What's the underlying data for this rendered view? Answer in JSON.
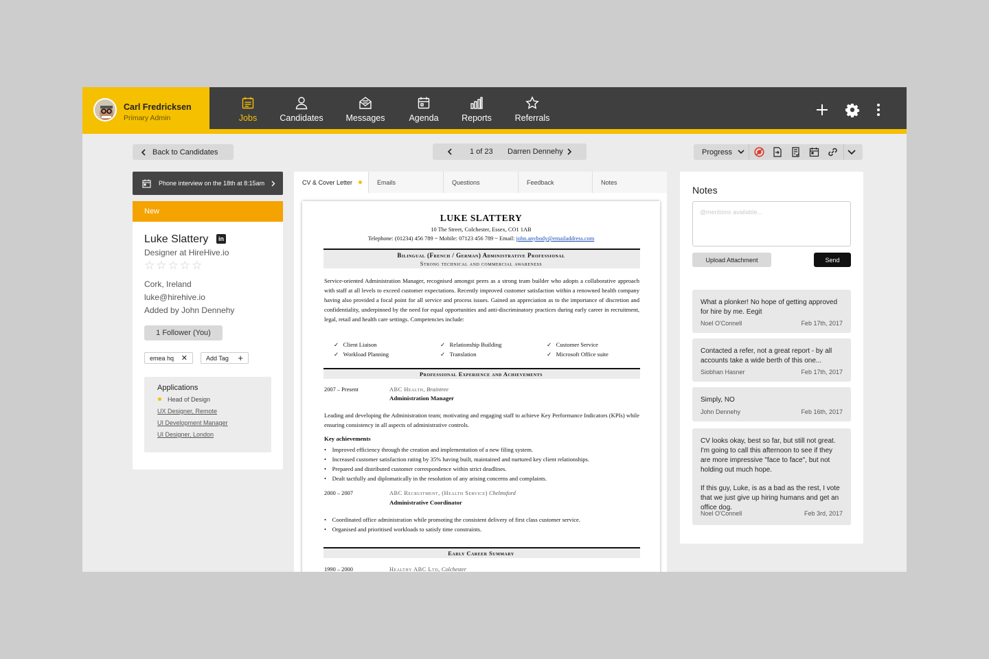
{
  "user": {
    "name": "Carl Fredricksen",
    "role": "Primary Admin"
  },
  "nav": [
    {
      "label": "Jobs",
      "icon": "calendar-list-icon",
      "active": true
    },
    {
      "label": "Candidates",
      "icon": "person-icon"
    },
    {
      "label": "Messages",
      "icon": "envelope-icon"
    },
    {
      "label": "Agenda",
      "icon": "calendar-icon"
    },
    {
      "label": "Reports",
      "icon": "bar-chart-icon"
    },
    {
      "label": "Referrals",
      "icon": "star-icon"
    }
  ],
  "top_actions": [
    "plus-icon",
    "gear-icon",
    "more-vertical-icon"
  ],
  "toolbar": {
    "back_label": "Back to Candidates",
    "pager_position": "1 of 23",
    "pager_name": "Darren Dennehy",
    "progress_label": "Progress"
  },
  "interview": {
    "text": "Phone interview on the 18th at 8:15am"
  },
  "candidate": {
    "status": "New",
    "name": "Luke Slattery",
    "title": "Designer at HireHive.io",
    "rating": 0,
    "stars": "☆☆☆☆☆",
    "location": "Cork, Ireland",
    "email": "luke@hirehive.io",
    "added_by": "Added by John Dennehy",
    "follower_label": "1 Follower (You)",
    "tags": [
      "emea hq"
    ],
    "add_tag_label": "Add Tag",
    "applications_title": "Applications",
    "applications": [
      "Head of Design",
      "UX Designer, Remote",
      "UI Development Manager",
      "UI Designer, London"
    ]
  },
  "tabs": [
    "CV & Cover Letter",
    "Emails",
    "Questions",
    "Feedback",
    "Notes"
  ],
  "cv": {
    "name": "LUKE SLATTERY",
    "address": "10 The Street, Colchester, Essex, CO1 1AB",
    "contact_prefix": "Telephone: (01234) 456 789 ~ Mobile: 07123 456 789 ~ Email: ",
    "contact_email": "john.anybody@emailaddress.com",
    "headline": "Bilingual (French / German) Administrative Professional",
    "subheadline": "Strong technical and commercial awareness",
    "summary": "Service-oriented Administration Manager, recognised amongst peers as a strong team builder who adopts a collaborative approach with staff at all levels to exceed customer expectations. Recently improved customer satisfaction within a renowned health company having also provided a focal point for all service and process issues. Gained an appreciation as to the importance of discretion and confidentiality, underpinned by the need for equal opportunities and anti-discriminatory practices during early career in recruitment, legal, retail and health care settings. Competencies include:",
    "competencies": [
      "Client Liaison",
      "Relationship Building",
      "Customer Service",
      "Workload Planning",
      "Translation",
      "Microsoft Office suite"
    ],
    "experience_heading": "Professional Experience and Achievements",
    "job1_dates": "2007 – Present",
    "job1_company": "ABC Health,",
    "job1_location": "Braintree",
    "job1_title": "Administration Manager",
    "job1_desc": "Leading and developing the Administration team; motivating and engaging staff to achieve Key Performance Indicators (KPIs) while ensuring consistency in all aspects of administrative controls.",
    "key_achievements_label": "Key achievements",
    "achievements": [
      "Improved efficiency through the creation and implementation of a new filing system.",
      "Increased customer satisfaction rating by 35% having built, maintained and nurtured key client relationships.",
      "Prepared and distributed customer correspondence within strict deadlines.",
      "Dealt tactfully and diplomatically in the resolution of any arising concerns and complaints."
    ],
    "job2_dates": "2000 – 2007",
    "job2_company": "ABC Recruitment, (Health Service)",
    "job2_location": "Chelmsford",
    "job2_title": "Administrative Coordinator",
    "job2_bullets": [
      "Coordinated office administration while promoting the consistent delivery of first class customer service.",
      "Organised and prioritised workloads to satisfy time constraints."
    ],
    "early_heading": "Early Career Summary",
    "job3_dates": "1990 – 2000",
    "job3_company": "Healthy ABC Ltd,",
    "job3_location": "Colchester"
  },
  "notes": {
    "title": "Notes",
    "placeholder": "@mentions available...",
    "upload_label": "Upload Attachment",
    "send_label": "Send",
    "items": [
      {
        "text": "What a plonker! No hope of getting approved for hire by me. Eegit",
        "author": "Noel O'Connell",
        "date": "Feb 17th, 2017"
      },
      {
        "text": "Contacted a refer, not a great report - by all accounts take a wide berth of this one...",
        "author": "Siobhan Hasner",
        "date": "Feb 17th, 2017"
      },
      {
        "text": "Simply, NO",
        "author": "John Dennehy",
        "date": "Feb 16th, 2017"
      },
      {
        "text": "CV looks okay, best so far, but still not great. I'm going to call this afternoon to see if they are more impressive \"face to face\", but not holding out much hope.",
        "text2": "If this guy, Luke, is as a bad as the rest, I vote that we just give up hiring humans and get an office dog.",
        "author": "Noel O'Connell",
        "date": "Feb 3rd, 2017"
      }
    ]
  },
  "colors": {
    "accent": "#f5c000",
    "status_new": "#f5a300",
    "topbar": "#3f3f3f",
    "block_icon": "#e0392b"
  }
}
